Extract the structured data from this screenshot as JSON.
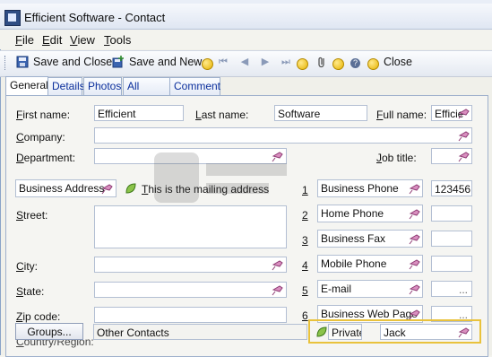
{
  "window": {
    "title": "Efficient Software - Contact"
  },
  "menu": [
    "File",
    "Edit",
    "View",
    "Tools"
  ],
  "toolbar": {
    "save_close": "Save and Close",
    "save_new": "Save and New",
    "close": "Close"
  },
  "tabs": [
    "General",
    "Details",
    "Photos",
    "All Fields",
    "Comment"
  ],
  "form": {
    "first_name_label": "First name:",
    "first_name_value": "Efficient",
    "last_name_label": "Last name:",
    "last_name_value": "Software",
    "full_name_label": "Full name:",
    "full_name_value": "Efficie",
    "company_label": "Company:",
    "company_value": "",
    "department_label": "Department:",
    "department_value": "",
    "job_title_label": "Job title:",
    "job_title_value": "",
    "address_type": "Business Address",
    "mailing_address_label": "This is the mailing address",
    "street_label": "Street:",
    "city_label": "City:",
    "state_label": "State:",
    "zip_label": "Zip code:",
    "country_label": "Country/Region:",
    "groups_button": "Groups...",
    "groups_value": "Other Contacts",
    "private_label": "Private",
    "owner_value": "Jack"
  },
  "phones": [
    {
      "num": "1",
      "type": "Business Phone",
      "value": "123456"
    },
    {
      "num": "2",
      "type": "Home Phone",
      "value": ""
    },
    {
      "num": "3",
      "type": "Business Fax",
      "value": ""
    },
    {
      "num": "4",
      "type": "Mobile Phone",
      "value": ""
    },
    {
      "num": "5",
      "type": "E-mail",
      "value": "..."
    },
    {
      "num": "6",
      "type": "Business Web Page",
      "value": "..."
    }
  ],
  "icons": {
    "app": "contact-card-icon",
    "pin": "pushpin-icon",
    "save": "save-icon",
    "leaf": "leaf-icon"
  },
  "colors": {
    "highlight": "#e9c23c",
    "tab_link": "#0b2f9c"
  }
}
